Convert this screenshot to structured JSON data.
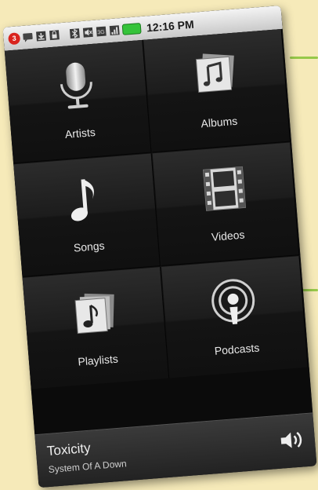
{
  "status_bar": {
    "notification_count": "3",
    "time": "12:16 PM",
    "icons": [
      "notification-badge-icon",
      "message-icon",
      "download-icon",
      "lock-icon",
      "bluetooth-icon",
      "mute-icon",
      "3g-icon",
      "signal-icon",
      "battery-icon"
    ]
  },
  "library": {
    "tiles": [
      {
        "label": "Artists",
        "icon": "microphone-icon"
      },
      {
        "label": "Albums",
        "icon": "albums-icon"
      },
      {
        "label": "Songs",
        "icon": "music-note-icon"
      },
      {
        "label": "Videos",
        "icon": "film-icon"
      },
      {
        "label": "Playlists",
        "icon": "playlists-icon"
      },
      {
        "label": "Podcasts",
        "icon": "podcast-icon"
      }
    ]
  },
  "now_playing": {
    "title": "Toxicity",
    "artist": "System Of A Down",
    "volume_icon": "speaker-icon"
  },
  "colors": {
    "background": "#f6eab9",
    "accent_line": "#96c84a",
    "battery": "#35c33a",
    "notification": "#d9231d"
  }
}
